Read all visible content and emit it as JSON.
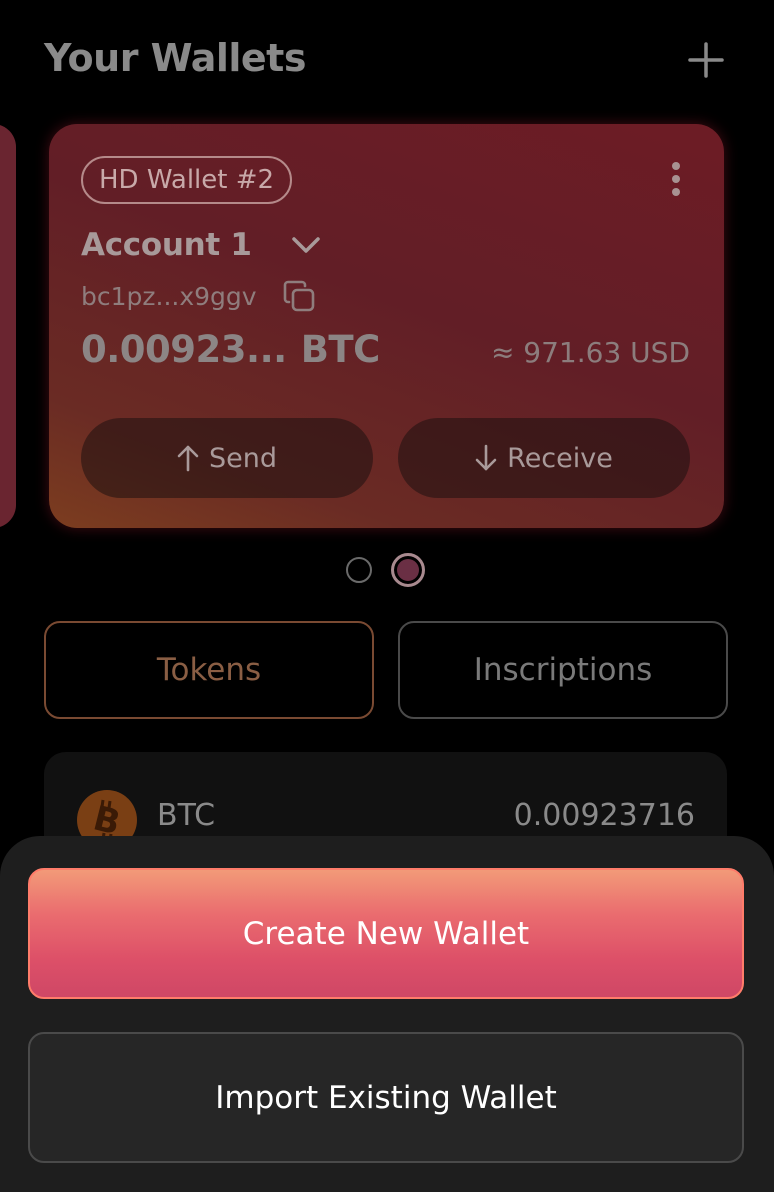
{
  "header": {
    "title": "Your Wallets",
    "add_icon": "plus-icon"
  },
  "wallet_card": {
    "badge": "HD Wallet #2",
    "menu_icon": "kebab-menu-icon",
    "account_name": "Account 1",
    "account_chevron_icon": "chevron-down-icon",
    "address": "bc1pz...x9ggv",
    "copy_icon": "copy-icon",
    "balance": "0.00923...",
    "balance_unit": "BTC",
    "fiat_value": "≈ 971.63 USD",
    "send_label": "Send",
    "send_icon": "arrow-up-icon",
    "receive_label": "Receive",
    "receive_icon": "arrow-down-icon"
  },
  "carousel": {
    "page_count": 2,
    "active_index": 1
  },
  "tabs": [
    {
      "label": "Tokens",
      "active": true
    },
    {
      "label": "Inscriptions",
      "active": false
    }
  ],
  "tokens": [
    {
      "icon": "bitcoin-icon",
      "name": "BTC",
      "amount": "0.00923716"
    }
  ],
  "bottom_sheet": {
    "create_label": "Create New Wallet",
    "import_label": "Import Existing Wallet"
  },
  "colors": {
    "background": "#000000",
    "card": "#6a1f27",
    "accent_gradient_top": "#f29a78",
    "accent_gradient_bottom": "#cf4766",
    "sheet": "#1e1e1e",
    "bitcoin": "#7a3f14"
  }
}
